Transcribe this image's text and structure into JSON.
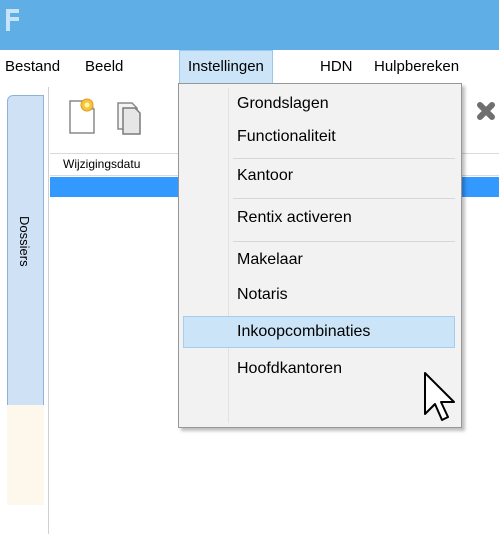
{
  "menubar": {
    "items": [
      "Bestand",
      "Beeld",
      "Instellingen",
      "HDN",
      "Hulpbereken"
    ],
    "active_index": 2
  },
  "sidebar": {
    "tab_label": "Dossiers"
  },
  "grid": {
    "column_header": "Wijzigingsdatu"
  },
  "dropdown": {
    "items": [
      "Grondslagen",
      "Functionaliteit",
      "Kantoor",
      "Rentix activeren",
      "Makelaar",
      "Notaris",
      "Inkoopcombinaties",
      "Hoofdkantoren"
    ],
    "highlighted_index": 6
  },
  "icons": [
    "app-icon",
    "new-document-icon",
    "copy-document-icon",
    "delete-icon",
    "mouse-pointer-icon"
  ],
  "colors": {
    "titlebar": "#5faee6",
    "menu_highlight": "#cce4f7",
    "selected_row": "#3399ff",
    "dossiers_tab": "#cfe2f5"
  }
}
